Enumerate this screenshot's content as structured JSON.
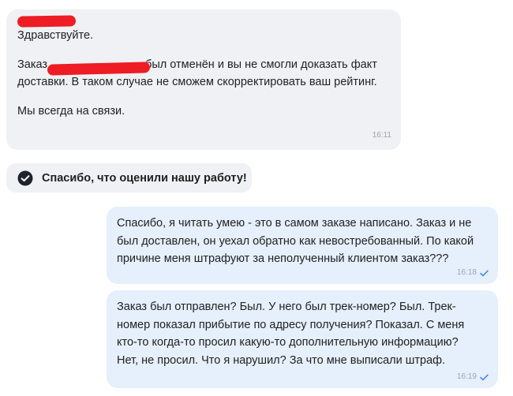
{
  "messages": {
    "incoming": {
      "greeting": "Здравствуйте.",
      "para2_prefix": "Заказ",
      "para2_rest": "был отменён и вы не смогли доказать факт доставки. В таком случае не сможем скорректировать ваш рейтинг.",
      "para3": "Мы всегда на связи.",
      "time": "16:11"
    },
    "system": {
      "text": "Спасибо, что оценили нашу работу!",
      "icon": "check-circle-icon"
    },
    "outgoing": [
      {
        "text": "Спасибо, я читать умею - это в самом заказе написано. Заказ и не\nбыл доставлен, он уехал обратно как невостребованный. По какой\nпричине меня штрафуют за неполученный клиентом заказ???",
        "time": "16:18",
        "status_icon": "sent-check-icon"
      },
      {
        "text": "Заказ был отправлен? Был. У него был трек-номер? Был. Трек-\nномер показал прибытие по адресу получения? Показал. С меня\nкто-то когда-то просил какую-то дополнительную информацию?\nНет, не просил. Что я нарушил? За что мне выписали штраф.",
        "time": "16:19",
        "status_icon": "sent-check-icon"
      }
    ]
  },
  "colors": {
    "incoming_bg": "#f0f1f4",
    "outgoing_bg": "#e5f0fc",
    "redaction": "#ee1c24",
    "check_blue": "#3b82f6",
    "time_gray": "#9aa3ad"
  }
}
